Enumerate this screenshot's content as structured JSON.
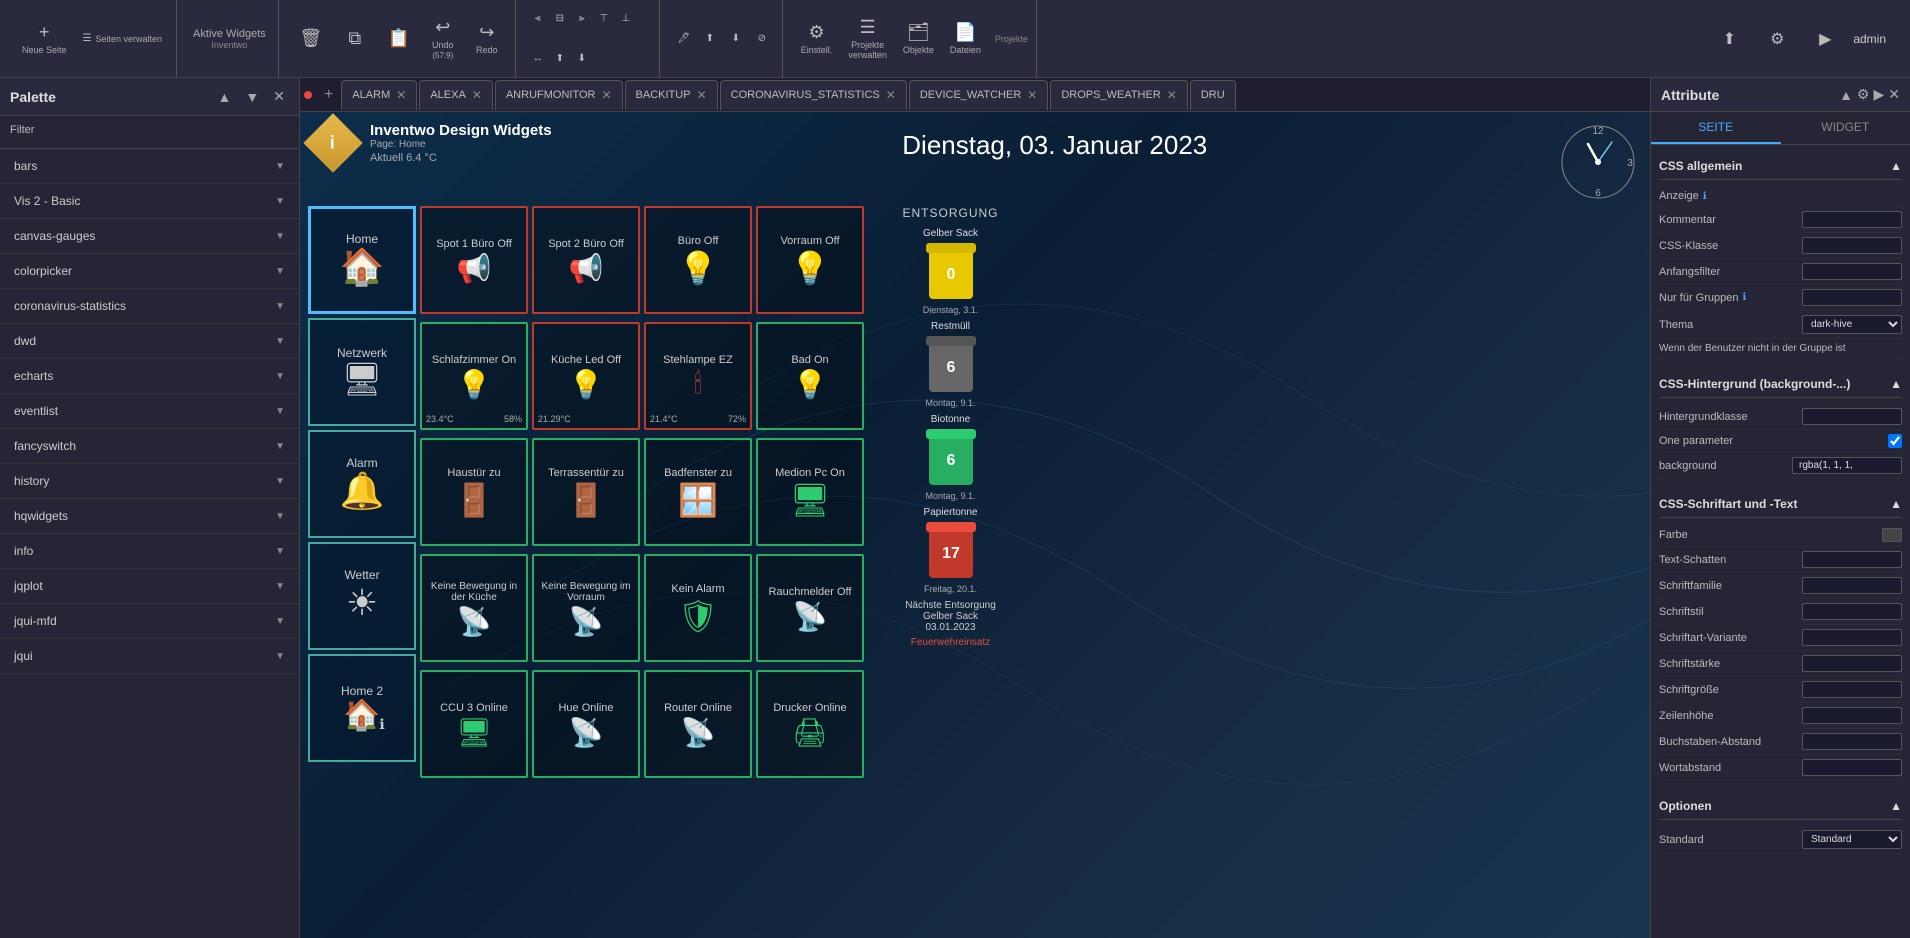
{
  "app": {
    "title": "Inventwo",
    "active_widgets": "Aktive Widgets"
  },
  "toolbar": {
    "neue_seite": "Neue Seite",
    "seiten_verwalten": "Seiten verwalten",
    "undo_label": "Undo",
    "undo_shortcut": "(57:9)",
    "redo_label": "Redo",
    "einstell": "Einstell.",
    "projekte_verwalten": "Projekte verwalten",
    "objekte": "Objekte",
    "dateien": "Dateien",
    "projekte_section": "Projekte",
    "widgets_section": "Widgets",
    "admin": "admin"
  },
  "palette": {
    "title": "Palette",
    "filter_label": "Filter",
    "items": [
      {
        "label": "bars"
      },
      {
        "label": "Vis 2 - Basic"
      },
      {
        "label": "canvas-gauges"
      },
      {
        "label": "colorpicker"
      },
      {
        "label": "coronavirus-statistics"
      },
      {
        "label": "dwd"
      },
      {
        "label": "echarts"
      },
      {
        "label": "eventlist"
      },
      {
        "label": "fancyswitch"
      },
      {
        "label": "history"
      },
      {
        "label": "hqwidgets"
      },
      {
        "label": "info"
      },
      {
        "label": "jqplot"
      },
      {
        "label": "jqui-mfd"
      },
      {
        "label": "jqui"
      }
    ]
  },
  "tabs": [
    {
      "label": "ALARM",
      "active": false
    },
    {
      "label": "ALEXA",
      "active": false
    },
    {
      "label": "ANRUFMONITOR",
      "active": false
    },
    {
      "label": "BACKITUP",
      "active": false
    },
    {
      "label": "CORONAVIRUS_STATISTICS",
      "active": false
    },
    {
      "label": "DEVICE_WATCHER",
      "active": false
    },
    {
      "label": "DROPS_WEATHER",
      "active": false
    },
    {
      "label": "DRU",
      "active": false
    }
  ],
  "canvas": {
    "logo_text": "i",
    "title": "Inventwo Design Widgets",
    "subtitle": "Page: Home",
    "weather": "Aktuell 6.4 °C",
    "date": "Dienstag, 03. Januar 2023",
    "nav_widgets": [
      {
        "label": "Home",
        "icon": "🏠",
        "selected": true
      },
      {
        "label": "Netzwerk",
        "icon": "🖥"
      },
      {
        "label": "Alarm",
        "icon": "🔔"
      },
      {
        "label": "Wetter",
        "icon": "☀"
      },
      {
        "label": "Home 2",
        "icon": "🏠"
      }
    ],
    "main_widgets": [
      [
        {
          "label": "Spot 1 Büro Off",
          "icon": "📢",
          "border": "red"
        },
        {
          "label": "Spot 2 Büro Off",
          "icon": "📢",
          "border": "red"
        },
        {
          "label": "Büro Off",
          "icon": "💡",
          "border": "red"
        },
        {
          "label": "Vorraum Off",
          "icon": "💡",
          "border": "red"
        }
      ],
      [
        {
          "label": "Schlafzimmer On",
          "icon": "💡",
          "border": "green",
          "sub1": "23.4°C",
          "sub2": "58%"
        },
        {
          "label": "Küche Led Off",
          "icon": "💡",
          "border": "red",
          "sub1": "21.29°C"
        },
        {
          "label": "Stehlampe EZ",
          "icon": "🕯",
          "border": "red",
          "sub1": "21.4°C",
          "sub2": "72%"
        },
        {
          "label": "Bad On",
          "icon": "💡",
          "border": "green"
        }
      ],
      [
        {
          "label": "Haustür zu",
          "icon": "🚪",
          "border": "green"
        },
        {
          "label": "Terrassentür zu",
          "icon": "🚪",
          "border": "green"
        },
        {
          "label": "Badfenster zu",
          "icon": "🪟",
          "border": "green"
        },
        {
          "label": "Medion Pc On",
          "icon": "🖥",
          "border": "green"
        }
      ],
      [
        {
          "label": "Keine Bewegung in der Küche",
          "icon": "📡",
          "border": "green"
        },
        {
          "label": "Keine Bewegung im Vorraum",
          "icon": "📡",
          "border": "green"
        },
        {
          "label": "Kein Alarm",
          "icon": "🛡",
          "border": "green"
        },
        {
          "label": "Rauchmelder Off",
          "icon": "📡",
          "border": "green"
        }
      ],
      [
        {
          "label": "CCU 3 Online",
          "icon": "🖥",
          "border": "green"
        },
        {
          "label": "Hue Online",
          "icon": "📡",
          "border": "green"
        },
        {
          "label": "Router Online",
          "icon": "📡",
          "border": "green"
        },
        {
          "label": "Drucker Online",
          "icon": "🖨",
          "border": "green"
        }
      ]
    ],
    "entsorgung": {
      "title": "ENTSORGUNG",
      "bins": [
        {
          "label": "Gelber Sack",
          "number": "0",
          "date": "Dienstag, 3.1.",
          "type": "yellow"
        },
        {
          "label": "Restmüll",
          "number": "6",
          "date": "Montag, 9.1.",
          "type": "gray"
        },
        {
          "label": "Biotonne",
          "number": "6",
          "date": "Montag, 9.1.",
          "type": "green"
        },
        {
          "label": "Papiertonne",
          "number": "17",
          "date": "Freitag, 20.1.",
          "type": "red"
        }
      ],
      "naechste_label": "Nächste Entsorgung",
      "naechste_item": "Gelber Sack",
      "naechste_date": "03.01.2023",
      "feuerwehr": "Feuerwehreinsatz"
    }
  },
  "attributes": {
    "title": "Attribute",
    "tab_seite": "SEITE",
    "tab_widget": "WIDGET",
    "sections": [
      {
        "title": "CSS allgemein",
        "rows": [
          {
            "label": "Anzeige",
            "has_info": true,
            "value": ""
          },
          {
            "label": "Kommentar",
            "value": ""
          },
          {
            "label": "CSS-Klasse",
            "value": ""
          },
          {
            "label": "Anfangsfilter",
            "value": ""
          },
          {
            "label": "Nur für Gruppen",
            "has_info": true,
            "value": ""
          },
          {
            "label": "Thema",
            "value": "dark-hive"
          },
          {
            "label": "Wenn der Benutzer nicht in der Gruppe ist",
            "value": ""
          }
        ]
      },
      {
        "title": "CSS-Hintergrund (background-...)",
        "rows": [
          {
            "label": "Hintergrundklasse",
            "value": ""
          },
          {
            "label": "One parameter",
            "has_checkbox": true,
            "checked": true
          },
          {
            "label": "background",
            "value": "rgba(1, 1, 1,"
          }
        ]
      },
      {
        "title": "CSS-Schriftart und -Text",
        "rows": [
          {
            "label": "Farbe",
            "has_swatch": true,
            "value": ""
          },
          {
            "label": "Text-Schatten",
            "value": ""
          },
          {
            "label": "Schriftfamilie",
            "value": ""
          },
          {
            "label": "Schriftstil",
            "value": ""
          },
          {
            "label": "Schriftart-Variante",
            "value": ""
          },
          {
            "label": "Schriftstärke",
            "value": ""
          },
          {
            "label": "Schriftgröße",
            "value": ""
          },
          {
            "label": "Zeilenhöhe",
            "value": ""
          },
          {
            "label": "Buchstaben-Abstand",
            "value": ""
          },
          {
            "label": "Wortabstand",
            "value": ""
          }
        ]
      },
      {
        "title": "Optionen",
        "rows": [
          {
            "label": "Standard",
            "value": ""
          }
        ]
      }
    ]
  }
}
